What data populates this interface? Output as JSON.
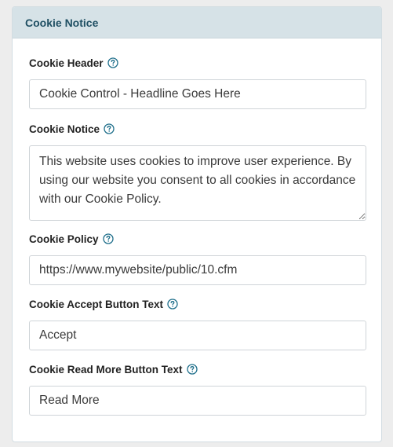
{
  "panel": {
    "title": "Cookie Notice"
  },
  "fields": {
    "cookie_header": {
      "label": "Cookie Header",
      "value": "Cookie Control - Headline Goes Here"
    },
    "cookie_notice": {
      "label": "Cookie Notice",
      "value": "This website uses cookies to improve user experience. By using our website you consent to all cookies in accordance with our Cookie Policy."
    },
    "cookie_policy": {
      "label": "Cookie Policy",
      "value": "https://www.mywebsite/public/10.cfm"
    },
    "accept_button_text": {
      "label": "Cookie Accept Button Text",
      "value": "Accept"
    },
    "read_more_button_text": {
      "label": "Cookie Read More Button Text",
      "value": "Read More"
    }
  },
  "icons": {
    "help": "question-circle-icon"
  },
  "colors": {
    "header_bg": "#d6e2e7",
    "header_text": "#1f4f63",
    "help_icon": "#1f6f8b"
  }
}
